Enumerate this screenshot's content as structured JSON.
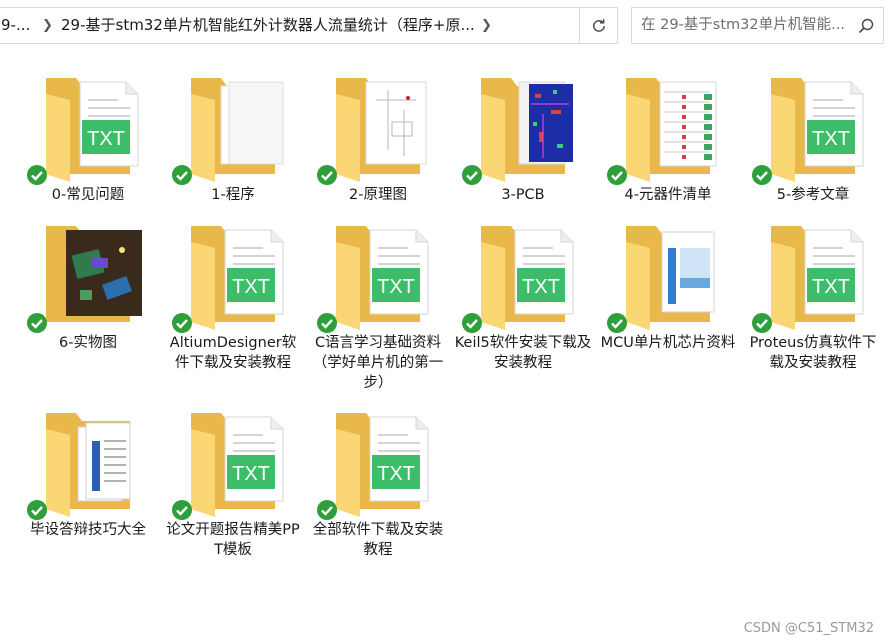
{
  "address": {
    "crumb_prefix": "9-...",
    "crumb_current": "29-基于stm32单片机智能红外计数器人流量统计（程序+原..."
  },
  "search": {
    "placeholder": "在 29-基于stm32单片机智能..."
  },
  "folders": [
    {
      "label": "0-常见问题",
      "preview": "txt",
      "synced": true
    },
    {
      "label": "1-程序",
      "preview": "blank",
      "synced": true
    },
    {
      "label": "2-原理图",
      "preview": "schematic",
      "synced": true
    },
    {
      "label": "3-PCB",
      "preview": "pcb",
      "synced": true
    },
    {
      "label": "4-元器件清单",
      "preview": "spreadsheet",
      "synced": true
    },
    {
      "label": "5-参考文章",
      "preview": "txt",
      "synced": true
    },
    {
      "label": "6-实物图",
      "preview": "photo",
      "synced": true
    },
    {
      "label": "AltiumDesigner软件下载及安装教程",
      "preview": "txt",
      "synced": true
    },
    {
      "label": "C语言学习基础资料（学好单片机的第一步）",
      "preview": "txt",
      "synced": true
    },
    {
      "label": "Keil5软件安装下载及安装教程",
      "preview": "txt",
      "synced": true
    },
    {
      "label": "MCU单片机芯片资料",
      "preview": "doc",
      "synced": true
    },
    {
      "label": "Proteus仿真软件下载及安装教程",
      "preview": "txt",
      "synced": true
    },
    {
      "label": "毕设答辩技巧大全",
      "preview": "docs",
      "synced": true
    },
    {
      "label": "论文开题报告精美PPT模板",
      "preview": "txt",
      "synced": true
    },
    {
      "label": "全部软件下载及安装教程",
      "preview": "txt",
      "synced": true
    }
  ],
  "icons": {
    "txt_badge": "TXT"
  },
  "watermark": "CSDN @C51_STM32",
  "colors": {
    "folder_back": "#e8b94a",
    "folder_front": "#fbd675",
    "txt_green": "#3dbd6a",
    "check_green": "#2e9f3a"
  }
}
